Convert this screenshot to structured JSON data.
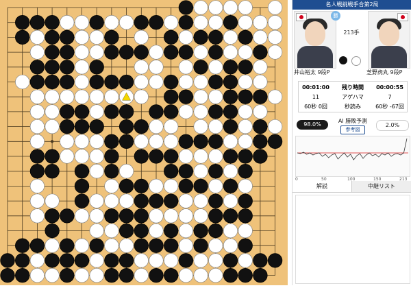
{
  "header": {
    "title": "名人戦挑戦手合第2局"
  },
  "players": {
    "black": {
      "name": "井山裕太  9段P",
      "flag_icon": "japan-flag-icon",
      "stone_color": "#111111",
      "win_badge": "勝"
    },
    "white": {
      "name": "芝野虎丸  9段P",
      "flag_icon": "japan-flag-icon",
      "stone_color": "#ffffff"
    }
  },
  "move_count": "213手",
  "info": {
    "time_remaining": {
      "black": "00:01:00",
      "label": "残り時間",
      "white": "00:00:55"
    },
    "prisoners": {
      "black": "11",
      "label": "アゲハマ",
      "white": "7"
    },
    "byoyomi": {
      "black": "60秒 0回",
      "label": "秒読み",
      "white": "60秒 -67回"
    }
  },
  "ai": {
    "black_pct": "98.0%",
    "label": "AI 勝敗予測",
    "white_pct": "2.0%",
    "reference_button": "参考図"
  },
  "graph": {
    "x_ticks": [
      "0",
      "50",
      "100",
      "150",
      "213"
    ],
    "line_color": "#333333",
    "baseline_color": "#e05050"
  },
  "tabs": [
    {
      "label": "解説"
    },
    {
      "label": "中継リスト"
    }
  ],
  "board": {
    "size": 19,
    "line_color": "#4a3a20",
    "stones": [
      "____________BWWWW_W",
      "_BBBWWBWWBBWBWWBWWW",
      "_BWBBWWB_W_BWBBWBWW",
      "__WBBWWBBBWBBWBWWBW",
      "__BBBWB__WW_WBWBBW_",
      "_WBBBWBBBWWBWWBBWW_",
      "__WWWWWWWW_BBWWBBBW",
      "__WWBBWBB_BBWWBBWW_",
      "__WWBBB_BBWW_WWBWBW",
      "__W_WWWBBWWWBBBWWBB",
      "__BBWWWB_BBBWWWBBB_",
      "__BB_BWBW__BBWBWB__",
      "__W__B_WBBWWBBWBW__",
      "__WW_BWWWBBBWWBWB__",
      "__WBBWWBBBWWWWBBB__",
      "___B__WWBBWBWBBWW__",
      "_BBWBWBWWBBBWBWWB__",
      "BBWBBBWBBWWWBWWBWBB",
      "BBWWBWWBBWBBWWWBBB_"
    ],
    "last_move_marker": "triangle"
  }
}
